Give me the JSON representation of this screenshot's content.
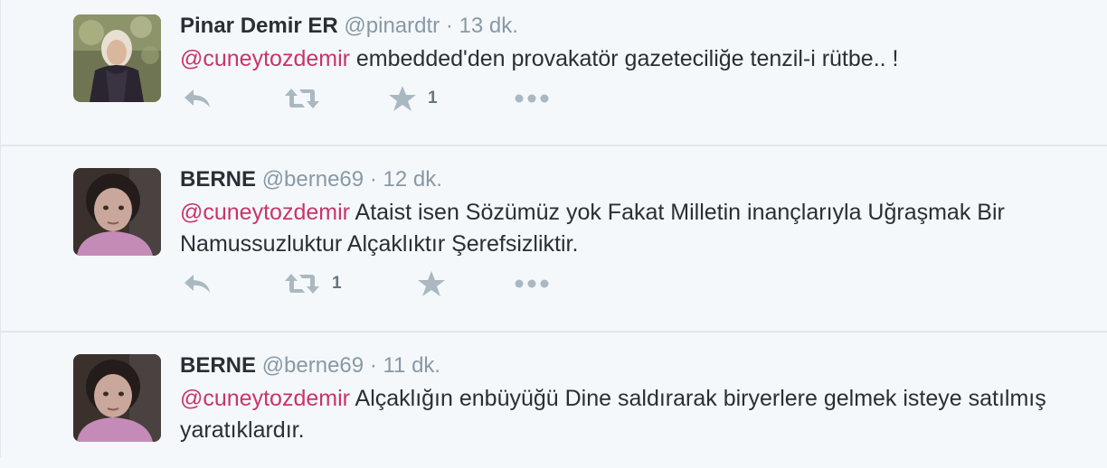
{
  "colors": {
    "mention": "#c8346a",
    "muted": "#8899a6",
    "icon": "#aab8c2",
    "background": "#f5f8fa"
  },
  "tweets": [
    {
      "name": "Pinar Demir ER",
      "handle": "@pinardtr",
      "sep": "·",
      "time": "13 dk.",
      "mention": "@cuneytozdemir",
      "body": " embedded'den provakatör gazeteciliğe tenzil-i rütbe.. !",
      "reply_icon": "reply-icon",
      "retweet_icon": "retweet-icon",
      "retweet_count": "",
      "favorite_icon": "star-icon",
      "favorite_count": "1",
      "more_icon": "more-dots-icon"
    },
    {
      "name": "BERNE",
      "handle": "@berne69",
      "sep": "·",
      "time": "12 dk.",
      "mention": "@cuneytozdemir",
      "body": " Ataist isen Sözümüz yok Fakat Milletin inançlarıyla Uğraşmak Bir Namussuzluktur Alçaklıktır Şerefsizliktir.",
      "reply_icon": "reply-icon",
      "retweet_icon": "retweet-icon",
      "retweet_count": "1",
      "favorite_icon": "star-icon",
      "favorite_count": "",
      "more_icon": "more-dots-icon"
    },
    {
      "name": "BERNE",
      "handle": "@berne69",
      "sep": "·",
      "time": "11 dk.",
      "mention": "@cuneytozdemir",
      "body": " Alçaklığın enbüyüğü Dine saldırarak biryerlere gelmek isteye satılmış yaratıklardır."
    }
  ]
}
